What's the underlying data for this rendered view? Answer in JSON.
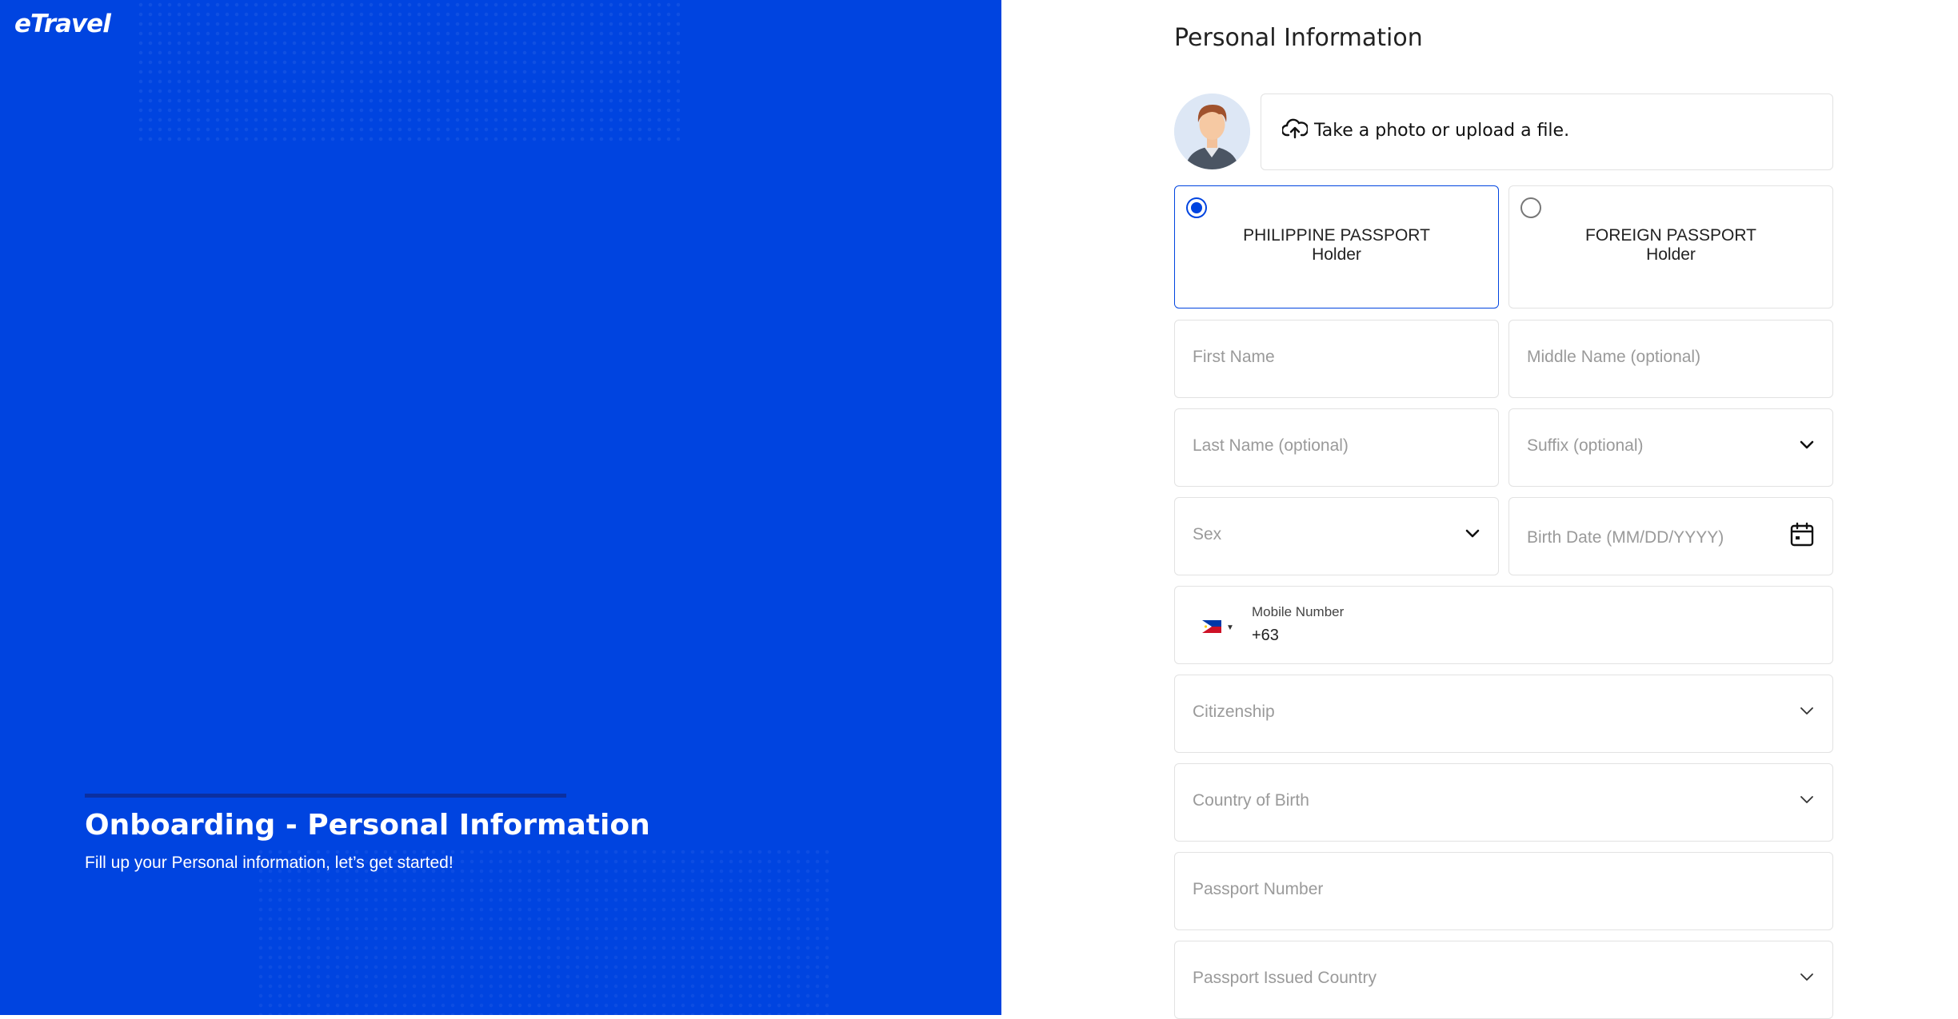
{
  "brand": {
    "logo_text": "eTravel",
    "primary_color": "#0044e0"
  },
  "onboarding": {
    "title": "Onboarding - Personal Information",
    "subtitle": "Fill up your Personal information, let’s get started!"
  },
  "form": {
    "title": "Personal Information",
    "upload_text": "Take a photo or upload a file.",
    "passport_options": [
      {
        "line1": "PHILIPPINE PASSPORT",
        "line2": "Holder",
        "selected": true
      },
      {
        "line1": "FOREIGN PASSPORT",
        "line2": "Holder",
        "selected": false
      }
    ],
    "first_name_placeholder": "First Name",
    "middle_name_placeholder": "Middle Name (optional)",
    "last_name_placeholder": "Last Name (optional)",
    "suffix_placeholder": "Suffix (optional)",
    "sex_placeholder": "Sex",
    "birth_date_placeholder": "Birth Date (MM/DD/YYYY)",
    "mobile_label": "Mobile Number",
    "mobile_value": "+63",
    "citizenship_placeholder": "Citizenship",
    "country_of_birth_placeholder": "Country of Birth",
    "passport_number_placeholder": "Passport Number",
    "passport_issued_country_placeholder": "Passport Issued Country"
  },
  "icons": {
    "upload": "cloud-upload-icon",
    "calendar": "calendar-icon",
    "chevron": "chevron-down-icon",
    "flag": "philippines-flag-icon",
    "avatar": "user-avatar-icon"
  }
}
